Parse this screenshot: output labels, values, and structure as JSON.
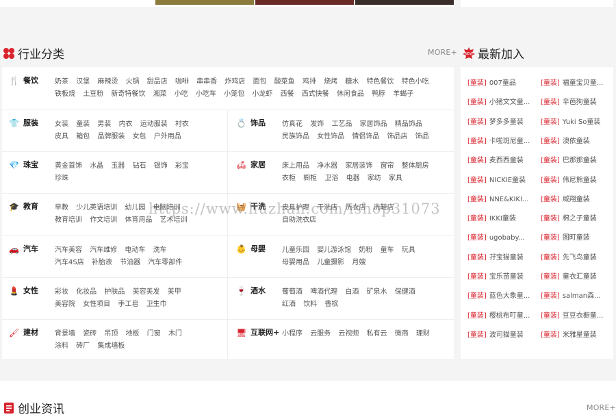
{
  "industry": {
    "title": "行业分类",
    "more": "MORE+",
    "rows": [
      {
        "left": {
          "name": "餐饮",
          "icon": "utensils-icon",
          "tags": [
            "奶茶",
            "汉堡",
            "麻辣烫",
            "火锅",
            "甜品店",
            "咖啡",
            "串串香",
            "炸鸡店",
            "面包",
            "酸菜鱼",
            "鸡排",
            "烧烤",
            "糖水",
            "特色餐饮",
            "特色小吃",
            "铁板烧",
            "土豆粉",
            "新奇特餐饮",
            "湘菜",
            "小吃",
            "小吃车",
            "小笼包",
            "小龙虾",
            "西餐",
            "西式快餐",
            "休闲食品",
            "鸭脖",
            "羊蝎子"
          ]
        }
      },
      {
        "left": {
          "name": "服装",
          "icon": "shirt-icon",
          "tags": [
            "女装",
            "童装",
            "男装",
            "内衣",
            "运动服装",
            "衬衣",
            "皮具",
            "箱包",
            "品牌服装",
            "女包",
            "户外用品"
          ]
        },
        "right": {
          "name": "饰品",
          "icon": "ring-icon",
          "tags": [
            "仿真花",
            "发饰",
            "工艺品",
            "家居饰品",
            "精品饰品",
            "民族饰品",
            "女性饰品",
            "情侣饰品",
            "饰品店",
            "饰品"
          ]
        }
      },
      {
        "left": {
          "name": "珠宝",
          "icon": "diamond-icon",
          "tags": [
            "黄金首饰",
            "水晶",
            "玉器",
            "钻石",
            "银饰",
            "彩宝",
            "珍珠"
          ]
        },
        "right": {
          "name": "家居",
          "icon": "sofa-icon",
          "tags": [
            "床上用品",
            "净水器",
            "家居装饰",
            "窗帘",
            "整体厨房",
            "衣柜",
            "橱柜",
            "卫浴",
            "电器",
            "家纺",
            "家具"
          ]
        }
      },
      {
        "left": {
          "name": "教育",
          "icon": "graduation-cap-icon",
          "tags": [
            "早教",
            "少儿英语培训",
            "幼儿园",
            "电脑培训",
            "教育培训",
            "作文培训",
            "体育用品",
            "艺术培训"
          ]
        },
        "right": {
          "name": "干洗",
          "icon": "laundry-icon",
          "tags": [
            "皮具护理",
            "干洗店",
            "洗衣店",
            "洗鞋店",
            "自助洗衣店"
          ]
        }
      },
      {
        "left": {
          "name": "汽车",
          "icon": "car-icon",
          "tags": [
            "汽车美容",
            "汽车维修",
            "电动车",
            "洗车",
            "汽车4S店",
            "补胎液",
            "节油器",
            "汽车零部件"
          ]
        },
        "right": {
          "name": "母婴",
          "icon": "stroller-icon",
          "tags": [
            "儿童乐园",
            "婴儿游泳馆",
            "奶粉",
            "童车",
            "玩具",
            "母婴用品",
            "儿童摄影",
            "月嫂"
          ]
        }
      },
      {
        "left": {
          "name": "女性",
          "icon": "cosmetics-icon",
          "tags": [
            "彩妆",
            "化妆品",
            "护肤品",
            "美容美发",
            "美甲",
            "美容院",
            "女性项目",
            "手工皂",
            "卫生巾"
          ]
        },
        "right": {
          "name": "酒水",
          "icon": "wine-bottle-icon",
          "tags": [
            "葡萄酒",
            "啤酒代理",
            "白酒",
            "矿泉水",
            "保健酒",
            "红酒",
            "饮料",
            "香槟"
          ]
        }
      },
      {
        "left": {
          "name": "建材",
          "icon": "paint-roller-icon",
          "tags": [
            "背景墙",
            "瓷砖",
            "吊顶",
            "地板",
            "门窗",
            "木门",
            "涂料",
            "砖厂",
            "集成墙板"
          ]
        },
        "right": {
          "name": "互联网+",
          "icon": "monitor-icon",
          "tags": [
            "小程序",
            "云服务",
            "云视频",
            "私有云",
            "微商",
            "理财"
          ]
        }
      }
    ]
  },
  "latest": {
    "title": "最新加入",
    "badge": "NEW",
    "items": [
      {
        "tag": "[童装]",
        "name": "007童品"
      },
      {
        "tag": "[童装]",
        "name": "福童宝贝童..."
      },
      {
        "tag": "[童装]",
        "name": "小猪文文童..."
      },
      {
        "tag": "[童装]",
        "name": "辛芭狗童装"
      },
      {
        "tag": "[童装]",
        "name": "梦多多童装"
      },
      {
        "tag": "[童装]",
        "name": "Yuki So童装"
      },
      {
        "tag": "[童装]",
        "name": "卡啦斑尼童..."
      },
      {
        "tag": "[童装]",
        "name": "澳依童装"
      },
      {
        "tag": "[童装]",
        "name": "麦西西童装"
      },
      {
        "tag": "[童装]",
        "name": "巴那那童装"
      },
      {
        "tag": "[童装]",
        "name": "NICKIE童装"
      },
      {
        "tag": "[童装]",
        "name": "伟尼熊童装"
      },
      {
        "tag": "[童装]",
        "name": "NNE&KIKI..."
      },
      {
        "tag": "[童装]",
        "name": "威翔童装"
      },
      {
        "tag": "[童装]",
        "name": "IKKI童装"
      },
      {
        "tag": "[童装]",
        "name": "棉之子童装"
      },
      {
        "tag": "[童装]",
        "name": "ugobaby..."
      },
      {
        "tag": "[童装]",
        "name": "图町童装"
      },
      {
        "tag": "[童装]",
        "name": "孖宝猫童装"
      },
      {
        "tag": "[童装]",
        "name": "先飞鸟童装"
      },
      {
        "tag": "[童装]",
        "name": "宝乐苗童装"
      },
      {
        "tag": "[童装]",
        "name": "童衣汇童装"
      },
      {
        "tag": "[童装]",
        "name": "蓝色大象童..."
      },
      {
        "tag": "[童装]",
        "name": "salman森..."
      },
      {
        "tag": "[童装]",
        "name": "樱桃布叮童..."
      },
      {
        "tag": "[童装]",
        "name": "豆豆衣橱童..."
      },
      {
        "tag": "[童装]",
        "name": "波司猫童装"
      },
      {
        "tag": "[童装]",
        "name": "米雅星童装"
      }
    ]
  },
  "news": {
    "title": "创业资讯",
    "more": "MORE+"
  },
  "watermark": "https://www.huzhan.com/ishop31073",
  "colors": {
    "accent": "#d9232d",
    "text": "#333333",
    "muted": "#555555"
  }
}
